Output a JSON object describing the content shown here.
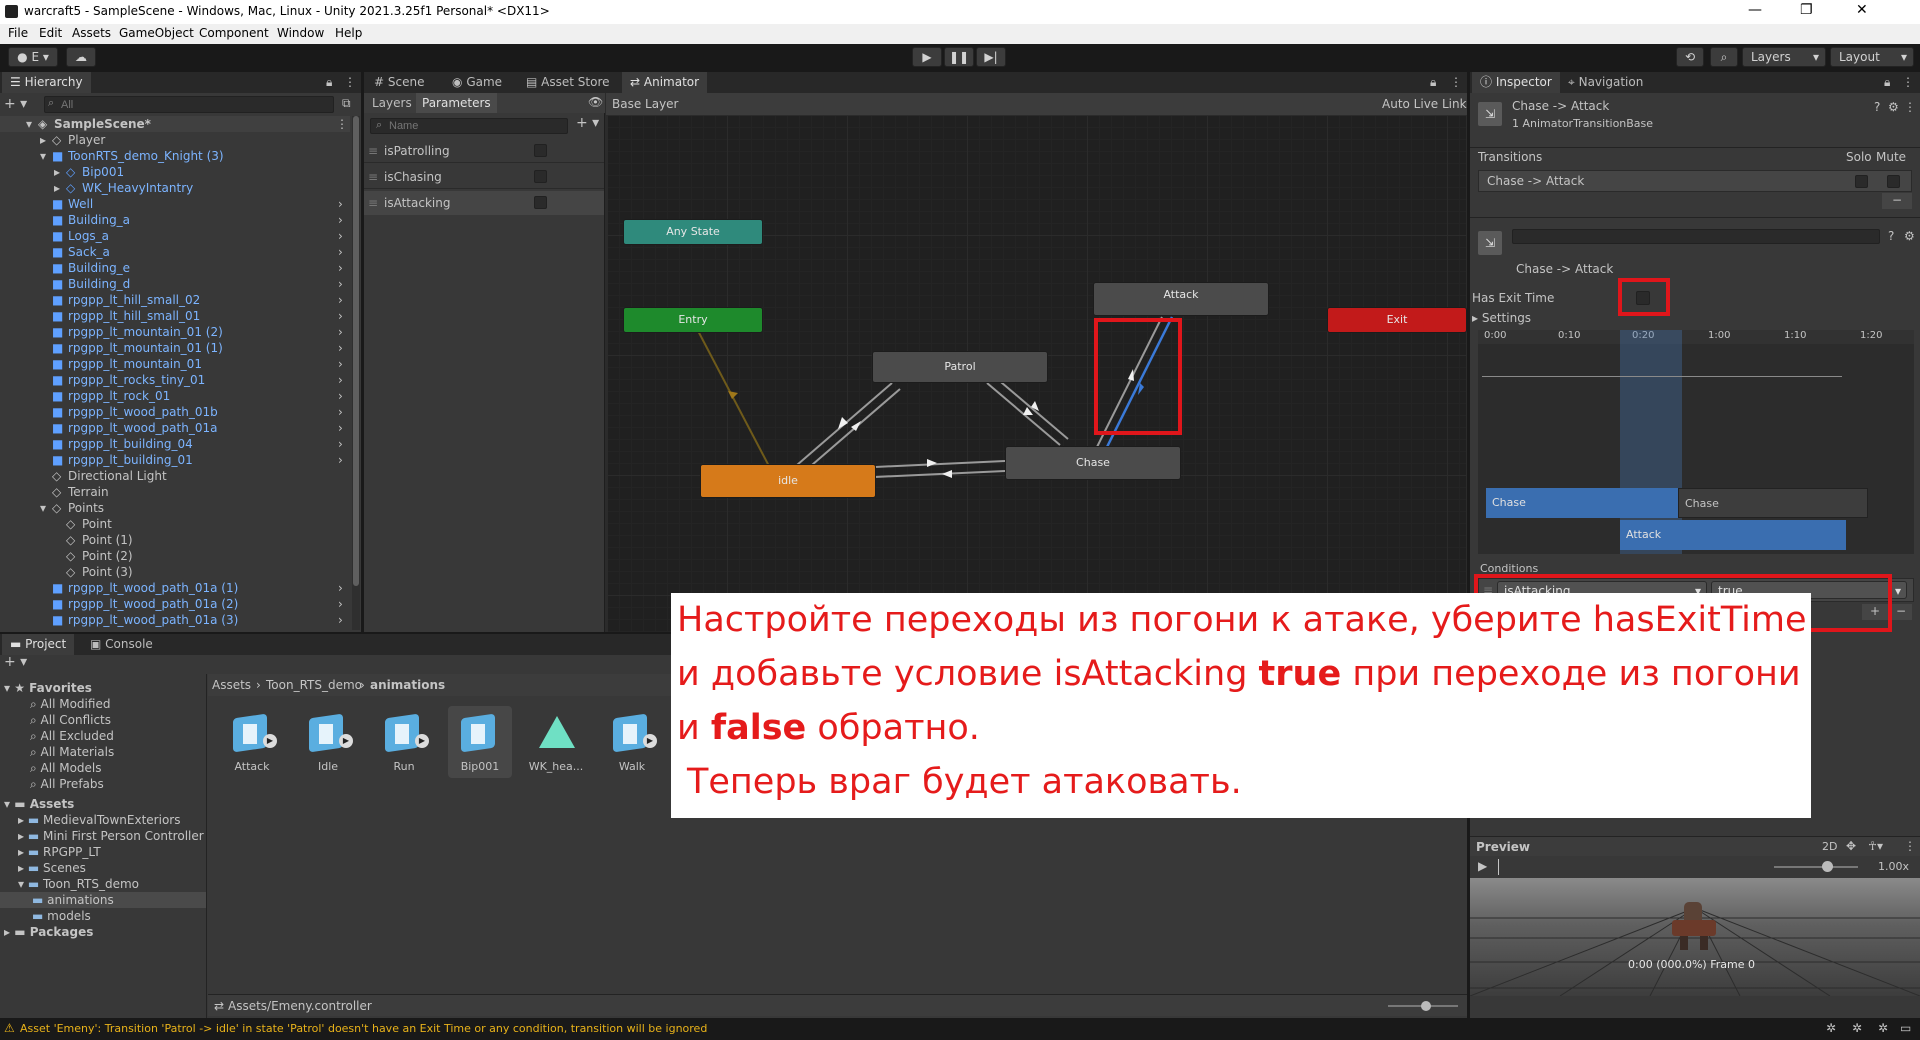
{
  "window": {
    "title": "warcraft5 - SampleScene - Windows, Mac, Linux - Unity 2021.3.25f1 Personal* <DX11>",
    "minimize": "—",
    "maximize": "❐",
    "close": "✕"
  },
  "menu": [
    "File",
    "Edit",
    "Assets",
    "GameObject",
    "Component",
    "Window",
    "Help"
  ],
  "toolbar": {
    "account_label": "E",
    "layers_label": "Layers",
    "layout_label": "Layout"
  },
  "hierarchy": {
    "tab": "Hierarchy",
    "search_placeholder": "All",
    "items": [
      {
        "label": "SampleScene*",
        "indent": 0,
        "kind": "scene"
      },
      {
        "label": "Player",
        "indent": 1,
        "kind": "obj"
      },
      {
        "label": "ToonRTS_demo_Knight (3)",
        "indent": 1,
        "kind": "prefab-open"
      },
      {
        "label": "Bip001",
        "indent": 2,
        "kind": "prefab-sub"
      },
      {
        "label": "WK_HeavyIntantry",
        "indent": 2,
        "kind": "prefab-sub"
      },
      {
        "label": "Well",
        "indent": 1,
        "kind": "prefab"
      },
      {
        "label": "Building_a",
        "indent": 1,
        "kind": "prefab"
      },
      {
        "label": "Logs_a",
        "indent": 1,
        "kind": "prefab"
      },
      {
        "label": "Sack_a",
        "indent": 1,
        "kind": "prefab"
      },
      {
        "label": "Building_e",
        "indent": 1,
        "kind": "prefab"
      },
      {
        "label": "Building_d",
        "indent": 1,
        "kind": "prefab"
      },
      {
        "label": "rpgpp_lt_hill_small_02",
        "indent": 1,
        "kind": "prefab"
      },
      {
        "label": "rpgpp_lt_hill_small_01",
        "indent": 1,
        "kind": "prefab"
      },
      {
        "label": "rpgpp_lt_mountain_01 (2)",
        "indent": 1,
        "kind": "prefab"
      },
      {
        "label": "rpgpp_lt_mountain_01 (1)",
        "indent": 1,
        "kind": "prefab"
      },
      {
        "label": "rpgpp_lt_mountain_01",
        "indent": 1,
        "kind": "prefab"
      },
      {
        "label": "rpgpp_lt_rocks_tiny_01",
        "indent": 1,
        "kind": "prefab"
      },
      {
        "label": "rpgpp_lt_rock_01",
        "indent": 1,
        "kind": "prefab"
      },
      {
        "label": "rpgpp_lt_wood_path_01b",
        "indent": 1,
        "kind": "prefab"
      },
      {
        "label": "rpgpp_lt_wood_path_01a",
        "indent": 1,
        "kind": "prefab"
      },
      {
        "label": "rpgpp_lt_building_04",
        "indent": 1,
        "kind": "prefab"
      },
      {
        "label": "rpgpp_lt_building_01",
        "indent": 1,
        "kind": "prefab"
      },
      {
        "label": "Directional Light",
        "indent": 1,
        "kind": "obj"
      },
      {
        "label": "Terrain",
        "indent": 1,
        "kind": "obj"
      },
      {
        "label": "Points",
        "indent": 1,
        "kind": "obj-open"
      },
      {
        "label": "Point",
        "indent": 2,
        "kind": "obj"
      },
      {
        "label": "Point (1)",
        "indent": 2,
        "kind": "obj"
      },
      {
        "label": "Point (2)",
        "indent": 2,
        "kind": "obj"
      },
      {
        "label": "Point (3)",
        "indent": 2,
        "kind": "obj"
      },
      {
        "label": "rpgpp_lt_wood_path_01a (1)",
        "indent": 1,
        "kind": "prefab"
      },
      {
        "label": "rpgpp_lt_wood_path_01a (2)",
        "indent": 1,
        "kind": "prefab"
      },
      {
        "label": "rpgpp_lt_wood_path_01a (3)",
        "indent": 1,
        "kind": "prefab"
      }
    ]
  },
  "center_tabs": [
    "Scene",
    "Game",
    "Asset Store",
    "Animator"
  ],
  "animator": {
    "layers_tab": "Layers",
    "parameters_tab": "Parameters",
    "search_placeholder": "Name",
    "parameters": [
      "isPatrolling",
      "isChasing",
      "isAttacking"
    ],
    "breadcrumb": "Base Layer",
    "auto_live_link": "Auto Live Link",
    "states": {
      "any_state": "Any State",
      "entry": "Entry",
      "exit": "Exit",
      "patrol": "Patrol",
      "idle": "idle",
      "chase": "Chase",
      "attack": "Attack"
    }
  },
  "inspector": {
    "tabs": [
      "Inspector",
      "Navigation"
    ],
    "header_title": "Chase -> Attack",
    "header_subtitle": "1 AnimatorTransitionBase",
    "transitions_label": "Transitions",
    "solo_label": "Solo",
    "mute_label": "Mute",
    "transition_row": "Chase -> Attack",
    "minus": "−",
    "name_label": "Chase -> Attack",
    "has_exit_time_label": "Has Exit Time",
    "settings_label": "Settings",
    "timeline_ticks": [
      "0:00",
      "0:10",
      "0:20",
      "1:00",
      "1:10",
      "1:20"
    ],
    "clip_chase_a": "Chase",
    "clip_chase_b": "Chase",
    "clip_attack": "Attack",
    "conditions_label": "Conditions",
    "condition_param": "isAttacking",
    "condition_value": "true",
    "plus": "+",
    "preview_label": "Preview",
    "preview_2d": "2D",
    "preview_speed": "1.00x",
    "preview_time": "0:00 (000.0%) Frame 0"
  },
  "project": {
    "tabs": [
      "Project",
      "Console"
    ],
    "favorites_label": "Favorites",
    "favorites": [
      "All Modified",
      "All Conflicts",
      "All Excluded",
      "All Materials",
      "All Models",
      "All Prefabs"
    ],
    "assets_label": "Assets",
    "assets_tree": [
      {
        "label": "MedievalTownExteriors",
        "indent": 1
      },
      {
        "label": "Mini First Person Controller",
        "indent": 1
      },
      {
        "label": "RPGPP_LT",
        "indent": 1
      },
      {
        "label": "Scenes",
        "indent": 1
      },
      {
        "label": "Toon_RTS_demo",
        "indent": 1
      },
      {
        "label": "animations",
        "indent": 2
      },
      {
        "label": "models",
        "indent": 2
      }
    ],
    "packages_label": "Packages",
    "breadcrumb": [
      "Assets",
      "Toon_RTS_demo",
      "animations"
    ],
    "assets": [
      {
        "label": "Attack",
        "icon": "model-anim"
      },
      {
        "label": "Idle",
        "icon": "model-anim"
      },
      {
        "label": "Run",
        "icon": "model-anim"
      },
      {
        "label": "Bip001",
        "icon": "model"
      },
      {
        "label": "WK_hea...",
        "icon": "mesh"
      },
      {
        "label": "Walk",
        "icon": "model-anim"
      }
    ],
    "footer_path": "Assets/Emeny.controller"
  },
  "status": {
    "message": "Asset 'Emeny': Transition 'Patrol -> idle' in state 'Patrol' doesn't have an Exit Time or any condition, transition will be ignored"
  },
  "overlay": {
    "line1": "Настройте переходы из погони к атаке, уберите hasExitTime",
    "line2_a": "и добавьте условие isAttacking ",
    "line2_b": "true",
    "line2_c": " при переходе из погони",
    "line3_a": "и ",
    "line3_b": "false",
    "line3_c": " обратно.",
    "line4": "Теперь враг будет атаковать."
  },
  "colors": {
    "entry": "#1e8a2c",
    "exit": "#c21a1a",
    "any_state": "#2f8a7c",
    "default_state": "#d67a1a",
    "state": "#4b4b4b",
    "highlight": "#e0161b",
    "selection": "#2c5d87"
  }
}
